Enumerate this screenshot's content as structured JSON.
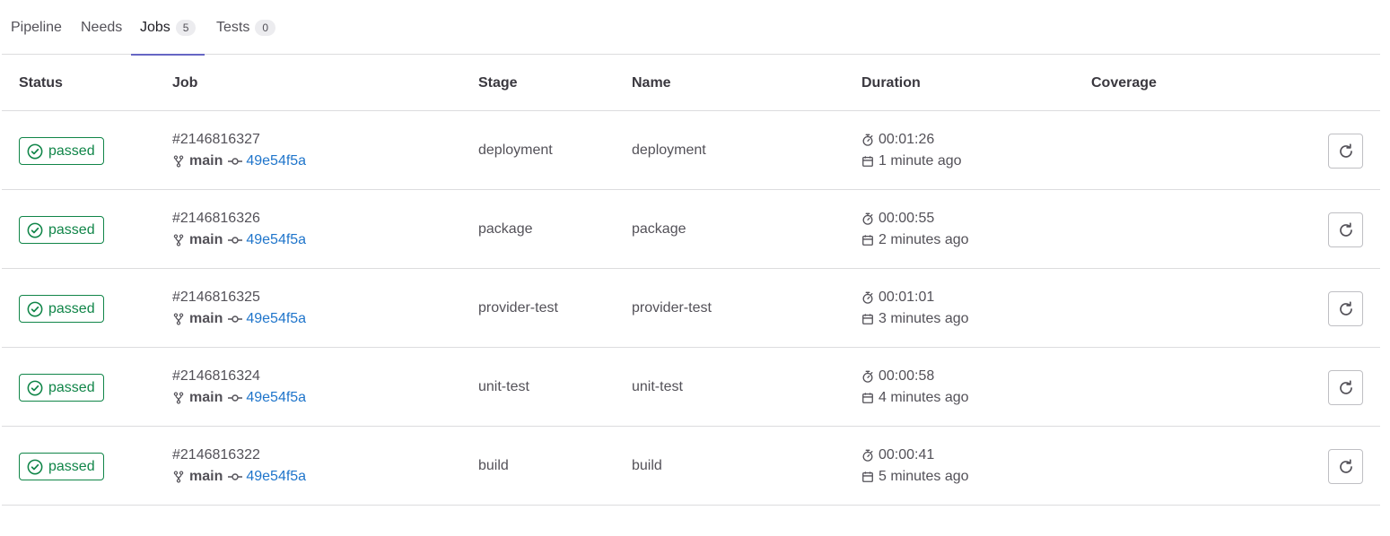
{
  "tabs": [
    {
      "label": "Pipeline",
      "count": null
    },
    {
      "label": "Needs",
      "count": null
    },
    {
      "label": "Jobs",
      "count": "5"
    },
    {
      "label": "Tests",
      "count": "0"
    }
  ],
  "active_tab": "Jobs",
  "columns": {
    "status": "Status",
    "job": "Job",
    "stage": "Stage",
    "name": "Name",
    "duration": "Duration",
    "coverage": "Coverage"
  },
  "jobs": [
    {
      "status": "passed",
      "id": "#2146816327",
      "branch": "main",
      "sha": "49e54f5a",
      "stage": "deployment",
      "name": "deployment",
      "duration": "00:01:26",
      "finished": "1 minute ago"
    },
    {
      "status": "passed",
      "id": "#2146816326",
      "branch": "main",
      "sha": "49e54f5a",
      "stage": "package",
      "name": "package",
      "duration": "00:00:55",
      "finished": "2 minutes ago"
    },
    {
      "status": "passed",
      "id": "#2146816325",
      "branch": "main",
      "sha": "49e54f5a",
      "stage": "provider-test",
      "name": "provider-test",
      "duration": "00:01:01",
      "finished": "3 minutes ago"
    },
    {
      "status": "passed",
      "id": "#2146816324",
      "branch": "main",
      "sha": "49e54f5a",
      "stage": "unit-test",
      "name": "unit-test",
      "duration": "00:00:58",
      "finished": "4 minutes ago"
    },
    {
      "status": "passed",
      "id": "#2146816322",
      "branch": "main",
      "sha": "49e54f5a",
      "stage": "build",
      "name": "build",
      "duration": "00:00:41",
      "finished": "5 minutes ago"
    }
  ],
  "icons": {
    "status": "check-circle-icon",
    "branch": "branch-icon",
    "commit": "commit-icon",
    "duration": "timer-icon",
    "finished": "calendar-icon",
    "retry": "retry-icon"
  },
  "colors": {
    "success": "#108548",
    "link": "#1f75cb",
    "tab_active_underline": "#6666c4"
  }
}
